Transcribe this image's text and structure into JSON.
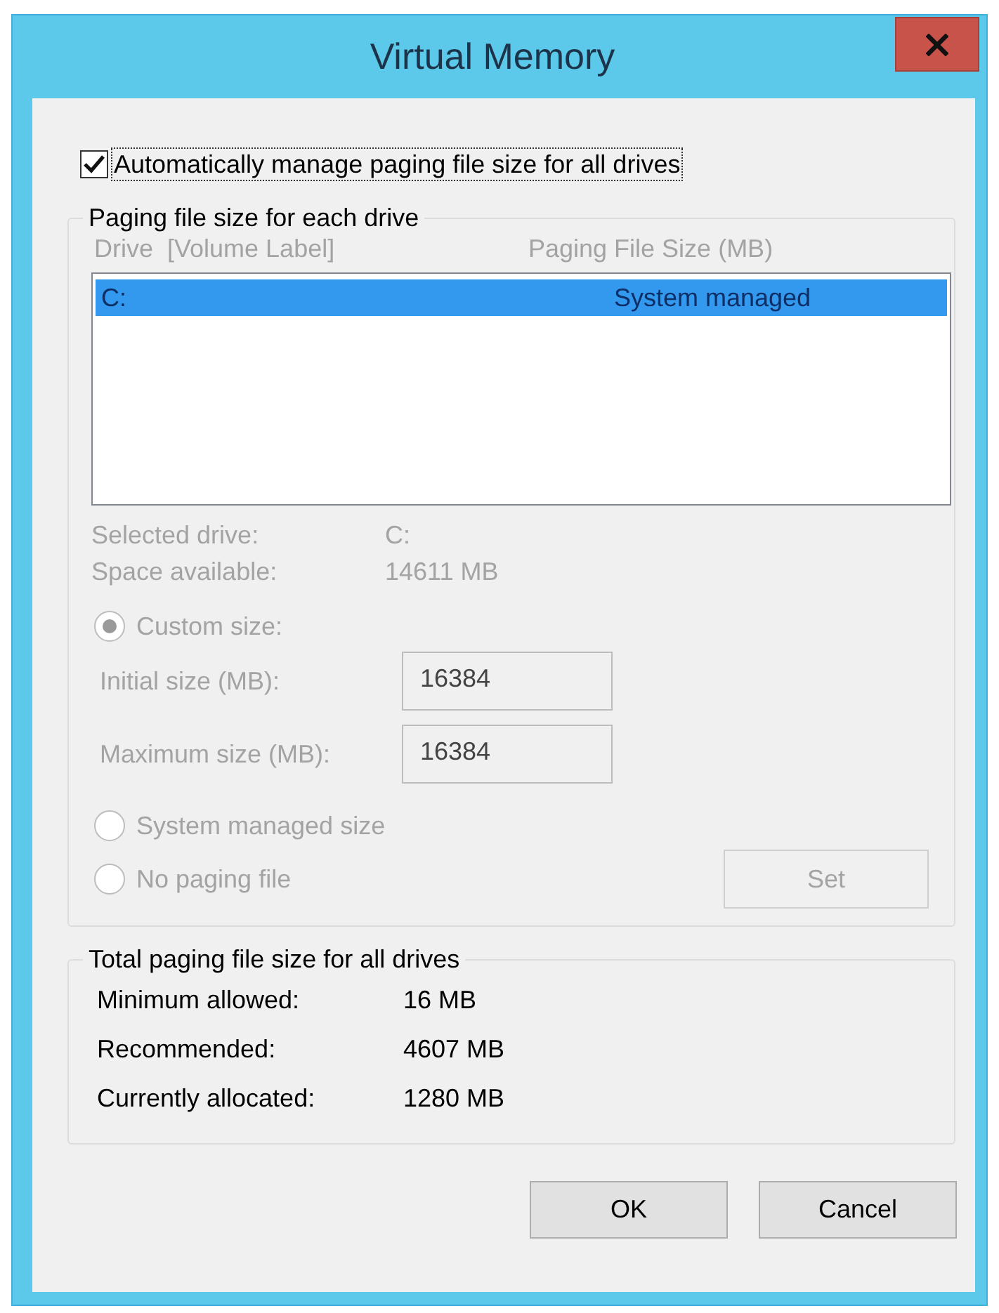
{
  "window": {
    "title": "Virtual Memory"
  },
  "auto_manage": {
    "label": "Automatically manage paging file size for all drives",
    "checked": true
  },
  "paging_group": {
    "title": "Paging file size for each drive",
    "disabled": true,
    "columns": [
      "Drive  [Volume Label]",
      "Paging File Size (MB)"
    ],
    "drives": [
      {
        "drive": "C:",
        "size": "System managed",
        "selected": true
      }
    ],
    "info": [
      {
        "label": "Selected drive:",
        "value": "C:"
      },
      {
        "label": "Space available:",
        "value": "14611 MB"
      }
    ],
    "size_options": [
      {
        "label": "Custom size:",
        "selected": true
      },
      {
        "label": "System managed size",
        "selected": false
      },
      {
        "label": "No paging file",
        "selected": false
      }
    ],
    "size_fields": [
      {
        "label": "Initial size (MB):",
        "value": "16384"
      },
      {
        "label": "Maximum size (MB):",
        "value": "16384"
      }
    ],
    "set_button": "Set"
  },
  "totals": {
    "title": "Total paging file size for all drives",
    "rows": [
      {
        "label": "Minimum allowed:",
        "value": "16 MB"
      },
      {
        "label": "Recommended:",
        "value": "4607 MB"
      },
      {
        "label": "Currently allocated:",
        "value": "1280 MB"
      }
    ]
  },
  "buttons": [
    {
      "label": "OK"
    },
    {
      "label": "Cancel"
    }
  ]
}
